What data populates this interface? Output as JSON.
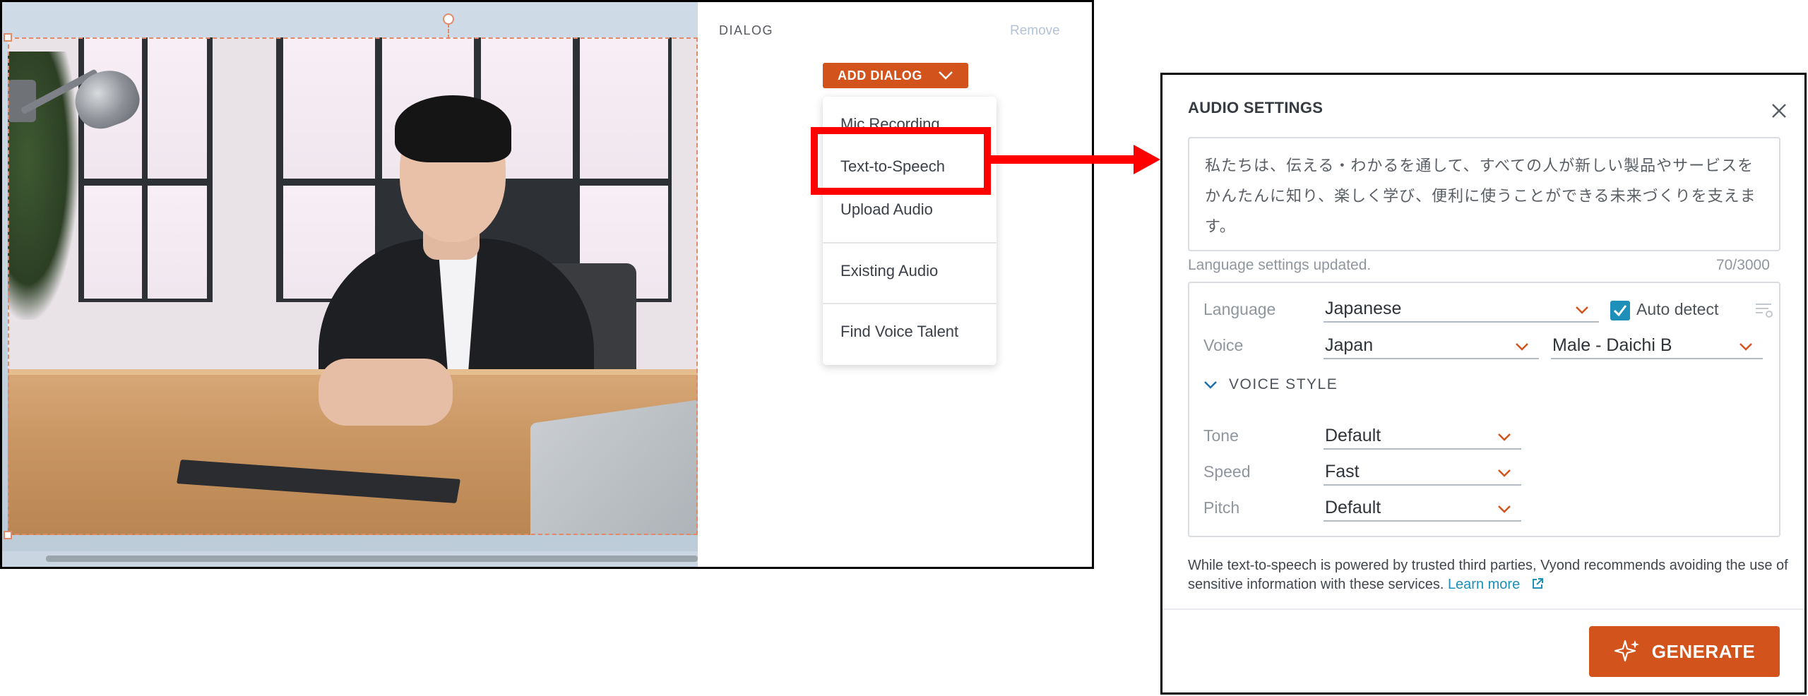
{
  "dialog_panel": {
    "title": "DIALOG",
    "remove_label": "Remove",
    "add_dialog_label": "ADD DIALOG",
    "menu": {
      "items": [
        {
          "label": "Mic Recording"
        },
        {
          "label": "Text-to-Speech"
        },
        {
          "label": "Upload Audio"
        },
        {
          "label": "Existing Audio"
        },
        {
          "label": "Find Voice Talent"
        }
      ]
    }
  },
  "audio_settings": {
    "title": "AUDIO SETTINGS",
    "text": "私たちは、伝える・わかるを通して、すべての人が新しい製品やサービスをかんたんに知り、楽しく学び、便利に使うことができる未来づくりを支えます。",
    "status": "Language settings updated.",
    "char_count": "70/3000",
    "language": {
      "label": "Language",
      "value": "Japanese"
    },
    "auto_detect": {
      "label": "Auto detect",
      "checked": true
    },
    "voice": {
      "label": "Voice",
      "region": "Japan",
      "speaker": "Male - Daichi B"
    },
    "voice_style": {
      "label": "VOICE STYLE",
      "tone": {
        "label": "Tone",
        "value": "Default"
      },
      "speed": {
        "label": "Speed",
        "value": "Fast"
      },
      "pitch": {
        "label": "Pitch",
        "value": "Default"
      }
    },
    "disclaimer": "While text-to-speech is powered by trusted third parties, Vyond recommends avoiding the use of sensitive information with these services.",
    "learn_more": "Learn more",
    "generate_label": "GENERATE"
  },
  "colors": {
    "accent": "#d2541c",
    "highlight": "#ff0000",
    "checkbox": "#1d8fb8"
  },
  "icons": [
    "chevron-down-icon",
    "close-icon",
    "checkmark-icon",
    "language-settings-icon",
    "external-link-icon",
    "sparkle-icon"
  ]
}
